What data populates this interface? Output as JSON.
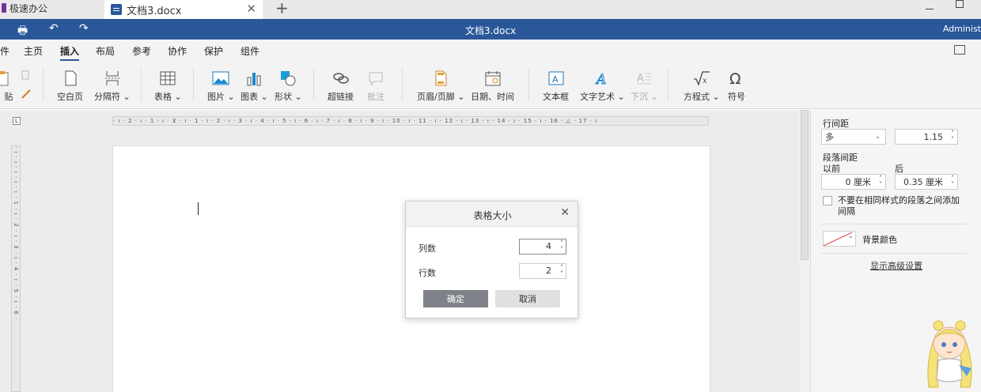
{
  "tabs": [
    {
      "label": "极速办公"
    },
    {
      "label": "文档3.docx"
    }
  ],
  "window": {
    "title": "文档3.docx",
    "user": "Administ"
  },
  "menu": {
    "items": [
      "件",
      "主页",
      "插入",
      "布局",
      "参考",
      "协作",
      "保护",
      "组件"
    ],
    "active": "插入"
  },
  "ribbon": {
    "paste": "贴",
    "blank_page": "空白页",
    "page_break": "分隔符",
    "table": "表格",
    "image": "图片",
    "chart": "图表",
    "shape": "形状",
    "hyperlink": "超链接",
    "comment": "批注",
    "header_footer": "页眉/页脚",
    "datetime": "日期、时间",
    "textbox": "文本框",
    "wordart": "文字艺术",
    "dropcap": "下沉",
    "equation": "方程式",
    "symbol": "符号"
  },
  "ruler": {
    "horizontal": "· ı · 2 · ı · 1 · ı · ⊻ · ı · 1 · ı · 2 · ı · 3 · ı · 4 · ı · 5 · ı · 6 · ı · 7 · ı · 8 · ı · 9 · ı · 10 · ı · 11 · ı · 12 · ı · 13 · ı · 14 · ı · 15 · ı · 16 · △ · 17 · ı",
    "vertical": "· ı · ı · ı · ı · ı · 1 · ı · 2 · ı · 3 · ı · 4 · ı · 5 · ı · 6 ·"
  },
  "panel": {
    "line_spacing_label": "行间距",
    "line_spacing_mode": "多",
    "line_spacing_value": "1.15",
    "para_spacing_label": "段落间距",
    "before_label": "以前",
    "after_label": "后",
    "before_value": "0 厘米",
    "after_value": "0.35 厘米",
    "no_add_spacing": "不要在相同样式的段落之间添加间隔",
    "bg_color_label": "背景颜色",
    "advanced_link": "显示高级设置"
  },
  "dialog": {
    "title": "表格大小",
    "columns_label": "列数",
    "columns_value": "4",
    "rows_label": "行数",
    "rows_value": "2",
    "ok": "确定",
    "cancel": "取消"
  },
  "colors": {
    "titlebar": "#2a579a",
    "ok_button": "#7f8289"
  }
}
